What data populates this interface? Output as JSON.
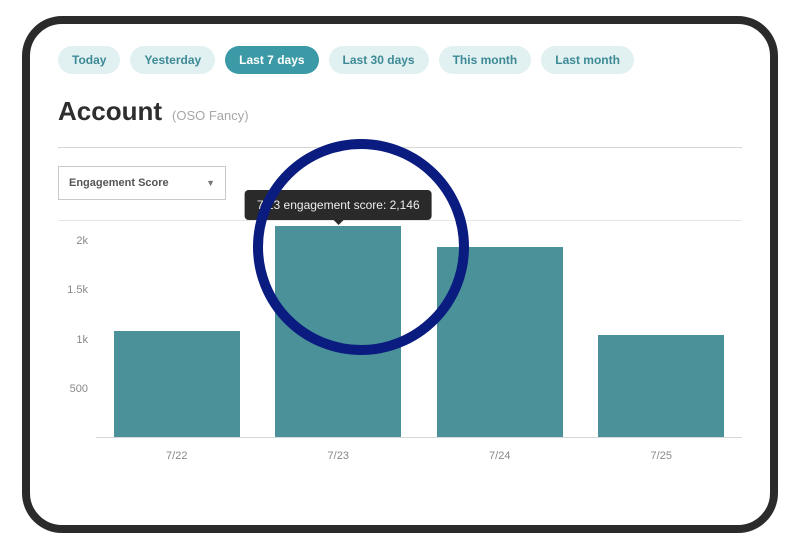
{
  "tabs": [
    {
      "label": "Today",
      "active": false
    },
    {
      "label": "Yesterday",
      "active": false
    },
    {
      "label": "Last 7 days",
      "active": true
    },
    {
      "label": "Last 30 days",
      "active": false
    },
    {
      "label": "This month",
      "active": false
    },
    {
      "label": "Last month",
      "active": false
    }
  ],
  "heading": {
    "title": "Account",
    "subtitle": "(OSO Fancy)"
  },
  "dropdown": {
    "selected": "Engagement Score"
  },
  "tooltip": {
    "text": "7/23  engagement score: 2,146"
  },
  "chart_data": {
    "type": "bar",
    "categories": [
      "7/22",
      "7/23",
      "7/24",
      "7/25"
    ],
    "values": [
      1080,
      2146,
      1940,
      1040
    ],
    "yticks": [
      {
        "v": 500,
        "label": "500"
      },
      {
        "v": 1000,
        "label": "1k"
      },
      {
        "v": 1500,
        "label": "1.5k"
      },
      {
        "v": 2000,
        "label": "2k"
      }
    ],
    "ylim": [
      0,
      2200
    ],
    "title": "Engagement Score",
    "xlabel": "",
    "ylabel": ""
  }
}
